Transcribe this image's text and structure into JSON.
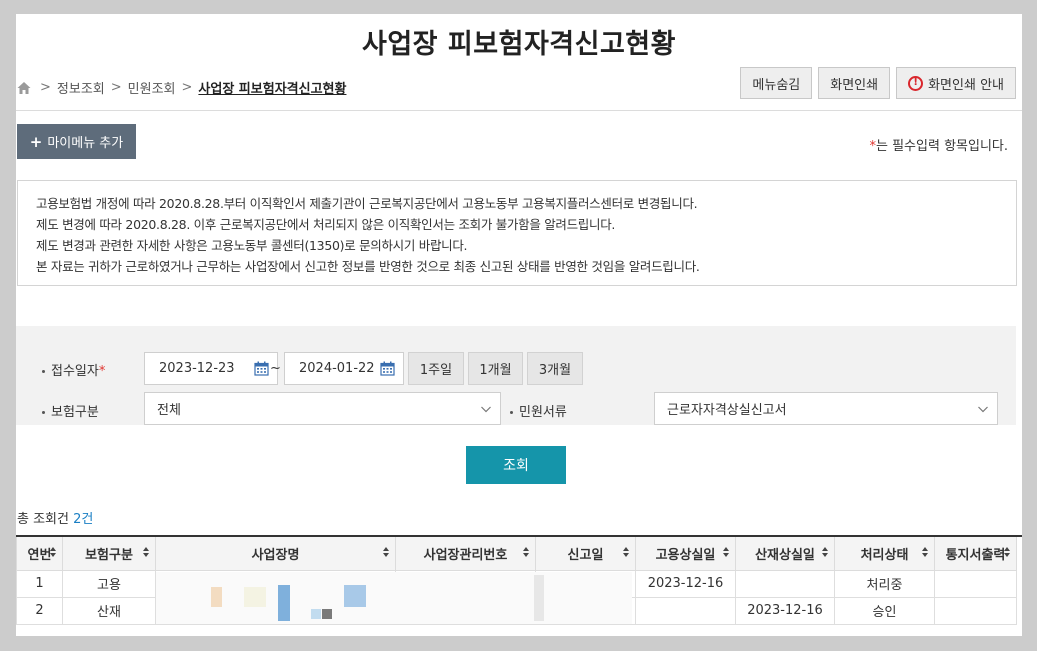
{
  "page_title": "사업장 피보험자격신고현황",
  "breadcrumb": {
    "items": [
      "정보조회",
      "민원조회"
    ],
    "current": "사업장 피보험자격신고현황",
    "separator": ">"
  },
  "top_buttons": {
    "hide_menu": "메뉴숨김",
    "print_screen": "화면인쇄",
    "print_guide": "화면인쇄 안내"
  },
  "my_menu_button": {
    "plus": "+",
    "label": "마이메뉴 추가"
  },
  "required_note": {
    "star": "*",
    "text": "는 필수입력 항목입니다."
  },
  "notice": {
    "lines": [
      "고용보험법 개정에 따라 2020.8.28.부터 이직확인서 제출기관이 근로복지공단에서 고용노동부 고용복지플러스센터로 변경됩니다.",
      "제도 변경에 따라 2020.8.28. 이후 근로복지공단에서 처리되지 않은 이직확인서는 조회가 불가함을 알려드립니다.",
      "제도 변경과 관련한 자세한 사항은 고용노동부 콜센터(1350)로 문의하시기 바랍니다.",
      "본 자료는 귀하가 근로하였거나 근무하는 사업장에서 신고한 정보를 반영한 것으로 최종 신고된 상태를 반영한 것임을 알려드립니다."
    ]
  },
  "search": {
    "receipt_date_label": "접수일자",
    "required_star": "*",
    "date_from": "2023-12-23",
    "tilde": "~",
    "date_to": "2024-01-22",
    "period_buttons": [
      "1주일",
      "1개월",
      "3개월"
    ],
    "insurance_type_label": "보험구분",
    "insurance_type_value": "전체",
    "document_label": "민원서류",
    "document_value": "근로자자격상실신고서",
    "search_button": "조회"
  },
  "result": {
    "total_prefix": "총 조회건",
    "total_count": "2건"
  },
  "table": {
    "headers": [
      "연번",
      "보험구분",
      "사업장명",
      "사업장관리번호",
      "신고일",
      "고용상실일",
      "산재상실일",
      "처리상태",
      "통지서출력"
    ],
    "rows": [
      [
        "1",
        "고용",
        "",
        "",
        "",
        "2023-12-16",
        "",
        "처리중",
        ""
      ],
      [
        "2",
        "산재",
        "",
        "",
        "",
        "",
        "2023-12-16",
        "승인",
        ""
      ]
    ]
  },
  "colors": {
    "accent": "#1595aa",
    "my_menu_bg": "#5e6c7b",
    "required": "#e0342f",
    "count": "#1a7fc4",
    "warn": "#d9262c"
  }
}
